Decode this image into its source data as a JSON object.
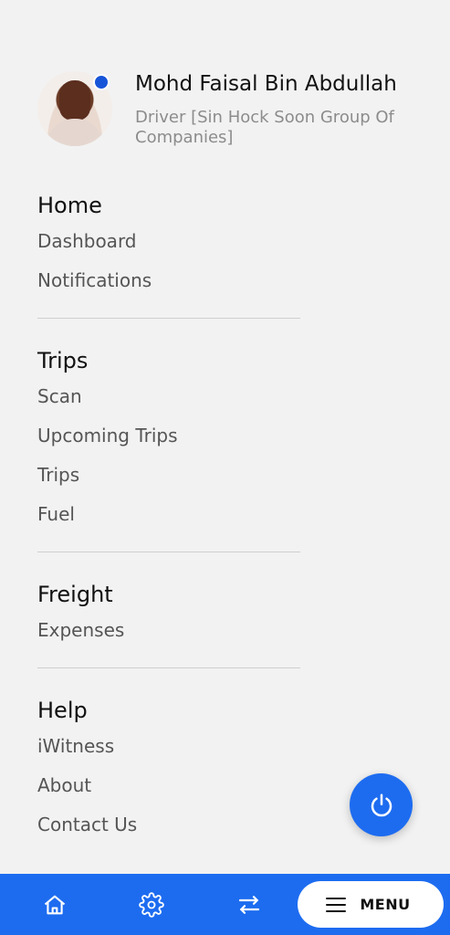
{
  "profile": {
    "name": "Mohd Faisal Bin Abdullah",
    "role": "Driver [Sin Hock Soon Group Of Companies]"
  },
  "menu": {
    "sections": [
      {
        "title": "Home",
        "items": [
          "Dashboard",
          "Notifications"
        ]
      },
      {
        "title": "Trips",
        "items": [
          "Scan",
          "Upcoming Trips",
          "Trips",
          "Fuel"
        ]
      },
      {
        "title": "Freight",
        "items": [
          "Expenses"
        ]
      },
      {
        "title": "Help",
        "items": [
          "iWitness",
          "About",
          "Contact Us"
        ]
      }
    ]
  },
  "bottom_nav": {
    "menu_label": "MENU",
    "icons": [
      "home-icon",
      "gear-icon",
      "transfer-icon",
      "hamburger-icon"
    ]
  },
  "colors": {
    "accent": "#1d6cf0",
    "status_dot": "#1755d8",
    "background": "#f2f2f2"
  }
}
